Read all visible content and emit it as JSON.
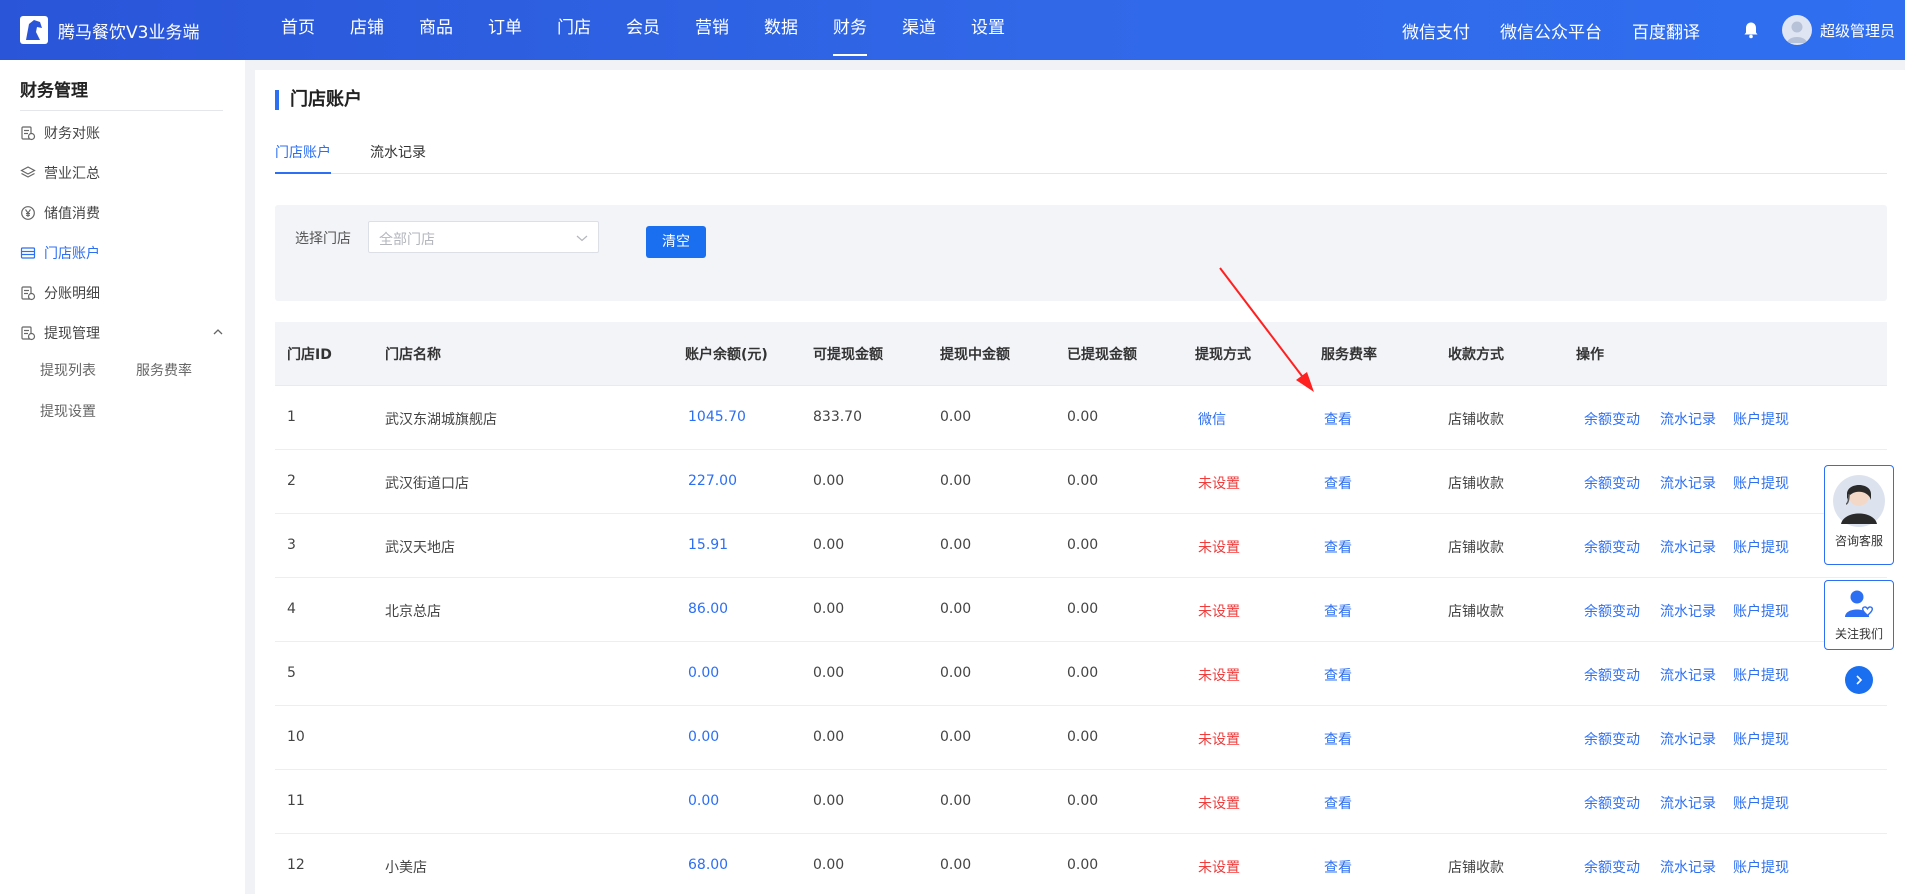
{
  "app": {
    "title": "腾马餐饮V3业务端"
  },
  "nav": {
    "items": [
      "首页",
      "店铺",
      "商品",
      "订单",
      "门店",
      "会员",
      "营销",
      "数据",
      "财务",
      "渠道",
      "设置"
    ],
    "active": "财务"
  },
  "top_links": [
    "微信支付",
    "微信公众平台",
    "百度翻译"
  ],
  "user": {
    "name": "超级管理员"
  },
  "sidebar": {
    "title": "财务管理",
    "items": [
      {
        "label": "财务对账",
        "icon": "ledger-icon"
      },
      {
        "label": "营业汇总",
        "icon": "layers-icon"
      },
      {
        "label": "储值消费",
        "icon": "yen-circle-icon"
      },
      {
        "label": "门店账户",
        "icon": "card-icon",
        "active": true
      },
      {
        "label": "分账明细",
        "icon": "ledger-icon"
      },
      {
        "label": "提现管理",
        "icon": "ledger-icon",
        "expanded": true
      }
    ],
    "sub_items": [
      "提现列表",
      "服务费率",
      "提现设置"
    ]
  },
  "page": {
    "title": "门店账户",
    "tabs": [
      "门店账户",
      "流水记录"
    ],
    "active_tab": "门店账户"
  },
  "filter": {
    "label": "选择门店",
    "select_placeholder": "全部门店",
    "clear_button": "清空"
  },
  "table": {
    "headers": [
      "门店ID",
      "门店名称",
      "账户余额(元)",
      "可提现金额",
      "提现中金额",
      "已提现金额",
      "提现方式",
      "服务费率",
      "收款方式",
      "操作"
    ],
    "actions": [
      "余额变动",
      "流水记录",
      "账户提现"
    ],
    "rows": [
      {
        "id": "1",
        "name": "武汉东湖城旗舰店",
        "balance": "1045.70",
        "withdrawable": "833.70",
        "pending": "0.00",
        "withdrawn": "0.00",
        "method": "微信",
        "method_set": true,
        "rate": "查看",
        "receive": "店铺收款"
      },
      {
        "id": "2",
        "name": "武汉街道口店",
        "balance": "227.00",
        "withdrawable": "0.00",
        "pending": "0.00",
        "withdrawn": "0.00",
        "method": "未设置",
        "method_set": false,
        "rate": "查看",
        "receive": "店铺收款"
      },
      {
        "id": "3",
        "name": "武汉天地店",
        "balance": "15.91",
        "withdrawable": "0.00",
        "pending": "0.00",
        "withdrawn": "0.00",
        "method": "未设置",
        "method_set": false,
        "rate": "查看",
        "receive": "店铺收款"
      },
      {
        "id": "4",
        "name": "北京总店",
        "balance": "86.00",
        "withdrawable": "0.00",
        "pending": "0.00",
        "withdrawn": "0.00",
        "method": "未设置",
        "method_set": false,
        "rate": "查看",
        "receive": "店铺收款"
      },
      {
        "id": "5",
        "name": "",
        "balance": "0.00",
        "withdrawable": "0.00",
        "pending": "0.00",
        "withdrawn": "0.00",
        "method": "未设置",
        "method_set": false,
        "rate": "查看",
        "receive": ""
      },
      {
        "id": "10",
        "name": "",
        "balance": "0.00",
        "withdrawable": "0.00",
        "pending": "0.00",
        "withdrawn": "0.00",
        "method": "未设置",
        "method_set": false,
        "rate": "查看",
        "receive": ""
      },
      {
        "id": "11",
        "name": "",
        "balance": "0.00",
        "withdrawable": "0.00",
        "pending": "0.00",
        "withdrawn": "0.00",
        "method": "未设置",
        "method_set": false,
        "rate": "查看",
        "receive": ""
      },
      {
        "id": "12",
        "name": "小美店",
        "balance": "68.00",
        "withdrawable": "0.00",
        "pending": "0.00",
        "withdrawn": "0.00",
        "method": "未设置",
        "method_set": false,
        "rate": "查看",
        "receive": "店铺收款"
      }
    ]
  },
  "floating": {
    "service_label": "咨询客服",
    "follow_label": "关注我们"
  },
  "colors": {
    "primary": "#2d6ff3",
    "topbar": "#3068e8",
    "warning": "#f23b3b",
    "annotation_arrow": "#ff2020"
  }
}
